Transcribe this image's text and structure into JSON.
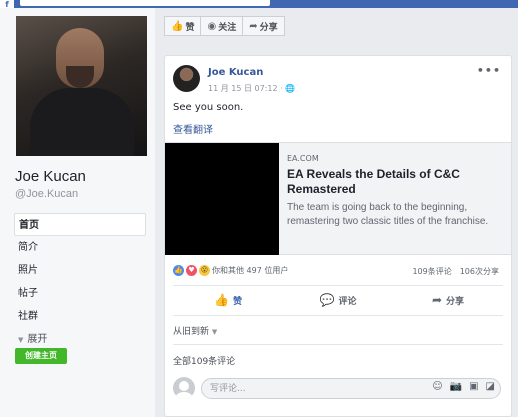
{
  "profile": {
    "name": "Joe Kucan",
    "handle": "@Joe.Kucan"
  },
  "nav": {
    "items": [
      {
        "label": "首页"
      },
      {
        "label": "简介"
      },
      {
        "label": "照片"
      },
      {
        "label": "帖子"
      },
      {
        "label": "社群"
      }
    ],
    "more_label": "展开",
    "create_page_label": "创建主页"
  },
  "action_buttons": {
    "like": "赞",
    "follow": "关注",
    "share": "分享"
  },
  "post": {
    "author": "Joe Kucan",
    "timestamp": "11 月 15 日 07:12 ·",
    "text": "See you soon.",
    "translate_label": "查看翻译",
    "link": {
      "domain": "EA.COM",
      "title": "EA Reveals the Details of C&C Remastered",
      "description": "The team is going back to the beginning, remastering two classic titles of the franchise."
    },
    "reactions_text": "你和其他 497 位用户",
    "comments_count": "109条评论",
    "shares_count": "106次分享",
    "bar": {
      "like": "赞",
      "comment": "评论",
      "share": "分享"
    },
    "sort_label": "从旧到新",
    "all_comments_label": "全部109条评论",
    "comment_placeholder": "写评论..."
  }
}
